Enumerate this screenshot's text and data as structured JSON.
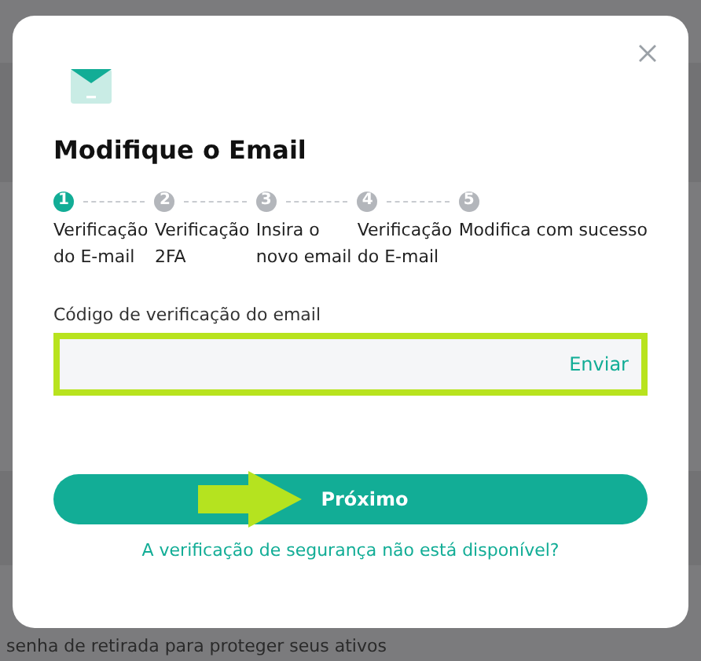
{
  "dialog": {
    "title": "Modifique o Email",
    "steps": [
      {
        "number": "1",
        "label": "Verificação do E-mail",
        "selected": true
      },
      {
        "number": "2",
        "label": "Verificação 2FA",
        "selected": false
      },
      {
        "number": "3",
        "label": "Insira o novo email",
        "selected": false
      },
      {
        "number": "4",
        "label": "Verificação do E-mail",
        "selected": false
      },
      {
        "number": "5",
        "label": "Modifica com sucesso",
        "selected": false
      }
    ],
    "field": {
      "label": "Código de verificação do email",
      "action": "Enviar",
      "highlighted": true
    },
    "primary_button": {
      "label": "Próximo",
      "pointer_arrow": true
    },
    "link": "A verificação de segurança não está disponível?"
  },
  "background": {
    "text": "senha de retirada para proteger seus ativos"
  }
}
